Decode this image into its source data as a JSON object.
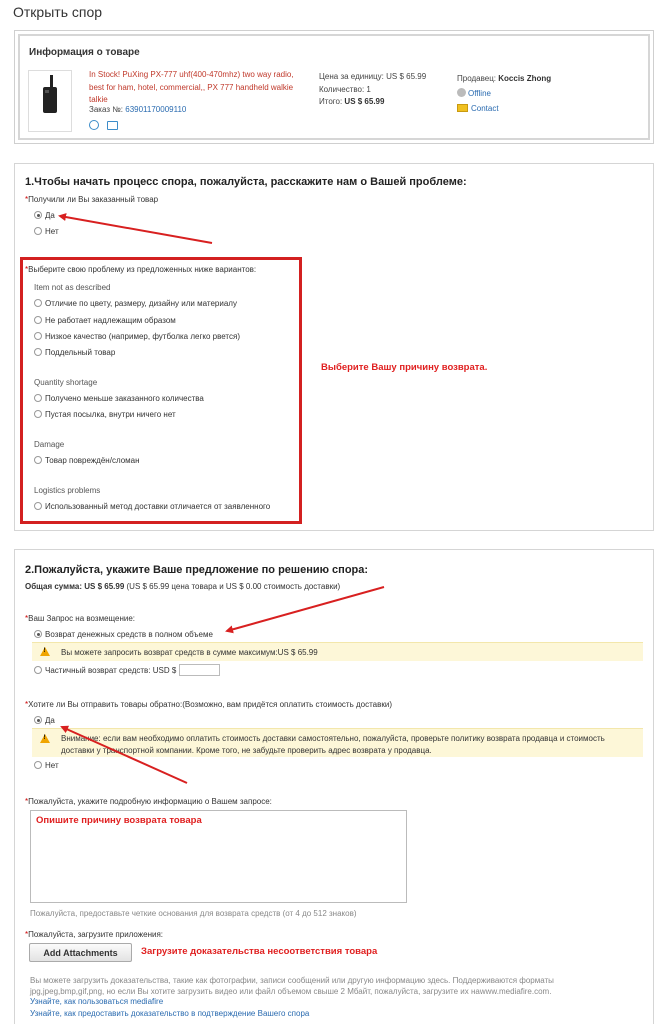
{
  "page": {
    "title": "Открыть спор"
  },
  "product": {
    "section_title": "Информация о товаре",
    "name": "In Stock! PuXing PX-777 uhf(400-470mhz) two way radio, best for ham, hotel, commercial,, PX 777 handheld walkie talkie",
    "order_label": "Заказ №:",
    "order_number": "63901170009110",
    "unit_price_label": "Цена за единицу:",
    "unit_price": "US $ 65.99",
    "quantity_label": "Количество:",
    "quantity": "1",
    "total_label": "Итого:",
    "total": "US $ 65.99",
    "seller_label": "Продавец:",
    "seller_name": "Koccis Zhong",
    "status": "Offline",
    "contact": "Contact"
  },
  "section1": {
    "title": "1.Чтобы начать процесс спора, пожалуйста, расскажите нам о Вашей проблеме:",
    "received_question": "Получили ли Вы заказанный товар",
    "received_yes": "Да",
    "received_no": "Нет",
    "problem_question": "Выберите свою проблему из предложенных ниже вариантов:",
    "groups": [
      {
        "title": "Item not as described",
        "options": [
          "Отличие по цвету, размеру, дизайну или материалу",
          "Не работает надлежащим образом",
          "Низкое качество (например, футболка легко рвется)",
          "Поддельный товар"
        ]
      },
      {
        "title": "Quantity shortage",
        "options": [
          "Получено меньше заказанного количества",
          "Пустая посылка, внутри ничего нет"
        ]
      },
      {
        "title": "Damage",
        "options": [
          "Товар повреждён/сломан"
        ]
      },
      {
        "title": "Logistics problems",
        "options": [
          "Использованный метод доставки отличается от заявленного"
        ]
      }
    ],
    "annotation": "Выберите Вашу причину возврата."
  },
  "section2": {
    "title": "2.Пожалуйста, укажите Ваше предложение по решению спора:",
    "total_label": "Общая сумма:",
    "total_value": "US $ 65.99",
    "total_detail": "(US $ 65.99 цена товара и US $ 0.00 стоимость доставки)",
    "refund_question": "Ваш Запрос на возмещение:",
    "refund_full": "Возврат денежных средств в полном объеме",
    "refund_full_warning": "Вы можете запросить возврат средств в сумме максимум:US $ 65.99",
    "refund_partial": "Частичный возврат средств: USD $",
    "return_question": "Хотите ли Вы отправить товары обратно:(Возможно, вам придётся оплатить стоимость доставки)",
    "return_yes": "Да",
    "return_warning": "Внимание: если вам необходимо оплатить стоимость доставки самостоятельно, пожалуйста, проверьте политику возврата продавца и стоимость доставки у транспортной компании. Кроме того, не забудьте проверить адрес возврата у продавца.",
    "return_no": "Нет",
    "details_question": "Пожалуйста, укажите подробную информацию о Вашем запросе:",
    "details_annotation": "Опишите причину возврата товара",
    "details_hint": "Пожалуйста, предоставьте четкие основания для возврата средств (от 4 до 512 знаков)",
    "attach_question": "Пожалуйста, загрузите приложения:",
    "attach_button": "Add Attachments",
    "attach_annotation": "Загрузите доказательства несоответствия товара",
    "fine_print": "Вы можете загрузить доказательства, такие как фотографии, записи сообщений или другую информацию здесь. Поддерживаются форматы jpg,jpeg,bmp,gif,png, но если Вы хотите загрузить видео или файл объемом свыше 2 Мбайт, пожалуйста, загрузите их наwww.mediafire.com.",
    "link1": "Узнайте, как пользоваться mediafire",
    "link2": "Узнайте, как предоставить доказательство в подтверждение Вашего спора"
  },
  "colors": {
    "annotation": "#e02020",
    "link": "#2a6bb0",
    "warning_bg": "#fdf7d8"
  }
}
